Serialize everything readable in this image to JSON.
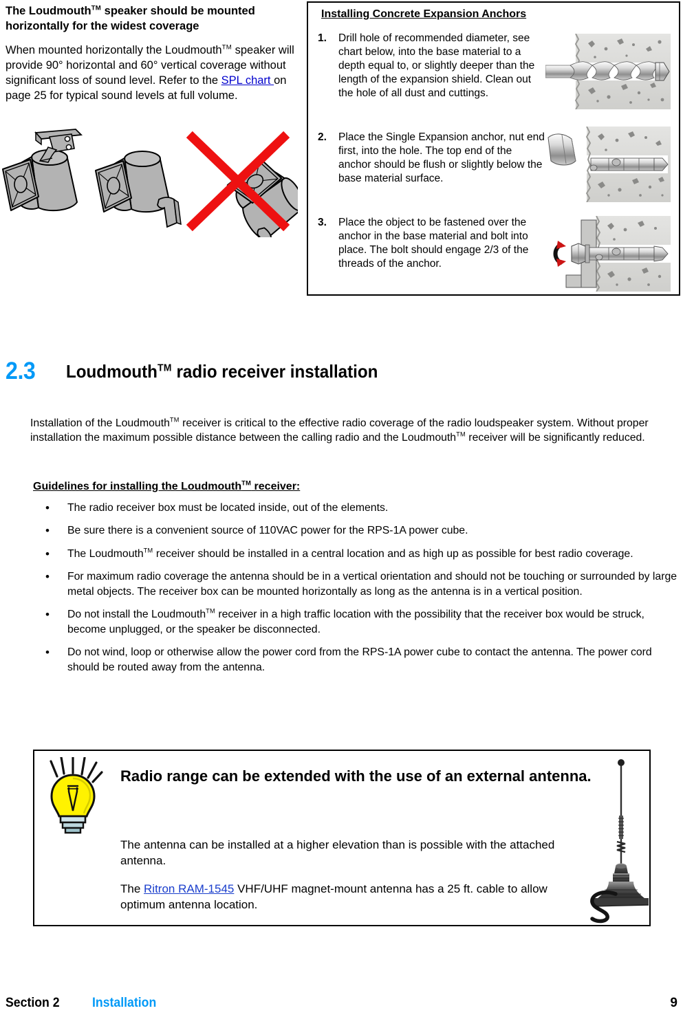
{
  "speaker_section": {
    "heading_pre": "The Loudmouth",
    "heading_tm": "TM",
    "heading_post": " speaker should be mounted horizontally for the widest coverage",
    "para_1": "When mounted horizontally the Loudmouth",
    "para_1_tm": "TM",
    "para_2": " speaker will provide 90° horizontal and 60° vertical coverage without significant loss of sound level.  Refer to the ",
    "link_text": "SPL chart ",
    "para_3": "on page 25 for typical sound levels at full volume.",
    "figure_alt": "three horn speaker orientations, two horizontal accepted and one vertical crossed out"
  },
  "anchors_box": {
    "title": "Installing Concrete Expansion Anchors",
    "steps": [
      {
        "number": "1.",
        "text": "Drill hole of recommended diameter, see chart below, into the base material to a depth equal to, or slightly deeper than the length of the expansion shield. Clean out the hole of all dust and cuttings.",
        "image_alt": "masonry drill bit boring hole in concrete"
      },
      {
        "number": "2.",
        "text": " Place the Single Expansion anchor, nut end first, into the hole. The top end of the anchor should be flush or slightly below the base material surface.",
        "image_alt": "hammer driving expansion anchor into hole in concrete"
      },
      {
        "number": "3.",
        "text": " Place the object to be fastened over the anchor in the base material and bolt into place. The bolt should engage 2/3 of the threads of the anchor.",
        "image_alt": "wrench tightening bolt into expansion anchor with rotation arrow"
      }
    ]
  },
  "section": {
    "number": "2.3",
    "title_pre": "Loudmouth",
    "title_tm": "TM",
    "title_post": " radio receiver installation"
  },
  "intro": {
    "part_1": "Installation of the Loudmouth",
    "tm_1": "TM",
    "part_2": " receiver is critical to the effective radio coverage of the radio loudspeaker system. Without proper installation the maximum possible distance between the calling radio and the Loudmouth",
    "tm_2": "TM",
    "part_3": " receiver will be significantly reduced."
  },
  "guidelines": {
    "heading_pre": "Guidelines for installing the Loudmouth",
    "heading_tm": "TM",
    "heading_post": " receiver:",
    "bullet_char": "•",
    "items": [
      {
        "part_1": "The radio receiver box must be located inside, out of the elements.",
        "tm": "",
        "part_2": ""
      },
      {
        "part_1": "Be sure there is a convenient source of 110VAC power for the RPS-1A power cube.",
        "tm": "",
        "part_2": ""
      },
      {
        "part_1": "The Loudmouth",
        "tm": "TM",
        "part_2": " receiver should be installed in a central location and as high up as possible for best radio coverage."
      },
      {
        "part_1": "For maximum radio coverage the antenna should be in a vertical orientation and should not be touching or surrounded by large metal objects. The receiver box can be mounted horizontally as long as the antenna is in a vertical position.",
        "tm": "",
        "part_2": ""
      },
      {
        "part_1": "Do not install the Loudmouth",
        "tm": "TM",
        "part_2": " receiver in a high traffic location with the possibility that the receiver box would be struck, become unplugged, or the speaker be disconnected."
      },
      {
        "part_1": "Do not wind, loop or otherwise allow the power cord from the RPS-1A power cube to contact the antenna. The power cord should be routed away from the antenna.",
        "tm": "",
        "part_2": ""
      }
    ]
  },
  "tip_box": {
    "icon_name": "lightbulb-icon",
    "heading": "Radio range can be extended with the use of an external antenna.",
    "para_1": "The antenna can be installed at a higher elevation than is possible with the attached antenna.",
    "para_2_pre": "The ",
    "link_text": "Ritron RAM-1545",
    "para_2_post": " VHF/UHF magnet-mount antenna has a 25 ft. cable to allow optimum antenna location.",
    "image_alt": "magnet-mount whip antenna with coiled cable"
  },
  "footer": {
    "section_label": "Section 2",
    "chapter_label": "Installation",
    "page_number": "9"
  },
  "colors": {
    "accent_blue": "#0099f7",
    "link_blue": "#0000cc",
    "bulb_yellow": "#ffef00",
    "cross_red": "#ee1111"
  }
}
